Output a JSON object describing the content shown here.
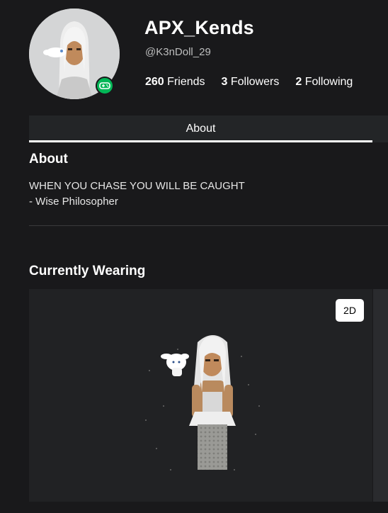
{
  "profile": {
    "display_name": "APX_Kends",
    "handle": "@K3nDoll_29",
    "status_icon": "gamepad-icon",
    "status_color": "#02b757"
  },
  "stats": [
    {
      "count": "260",
      "label": "Friends"
    },
    {
      "count": "3",
      "label": "Followers"
    },
    {
      "count": "2",
      "label": "Following"
    }
  ],
  "tabs": {
    "about_label": "About"
  },
  "about": {
    "title": "About",
    "line1": "WHEN YOU CHASE YOU WILL BE CAUGHT",
    "line2": "- Wise Philosopher"
  },
  "wearing": {
    "title": "Currently Wearing",
    "view_toggle": "2D"
  }
}
